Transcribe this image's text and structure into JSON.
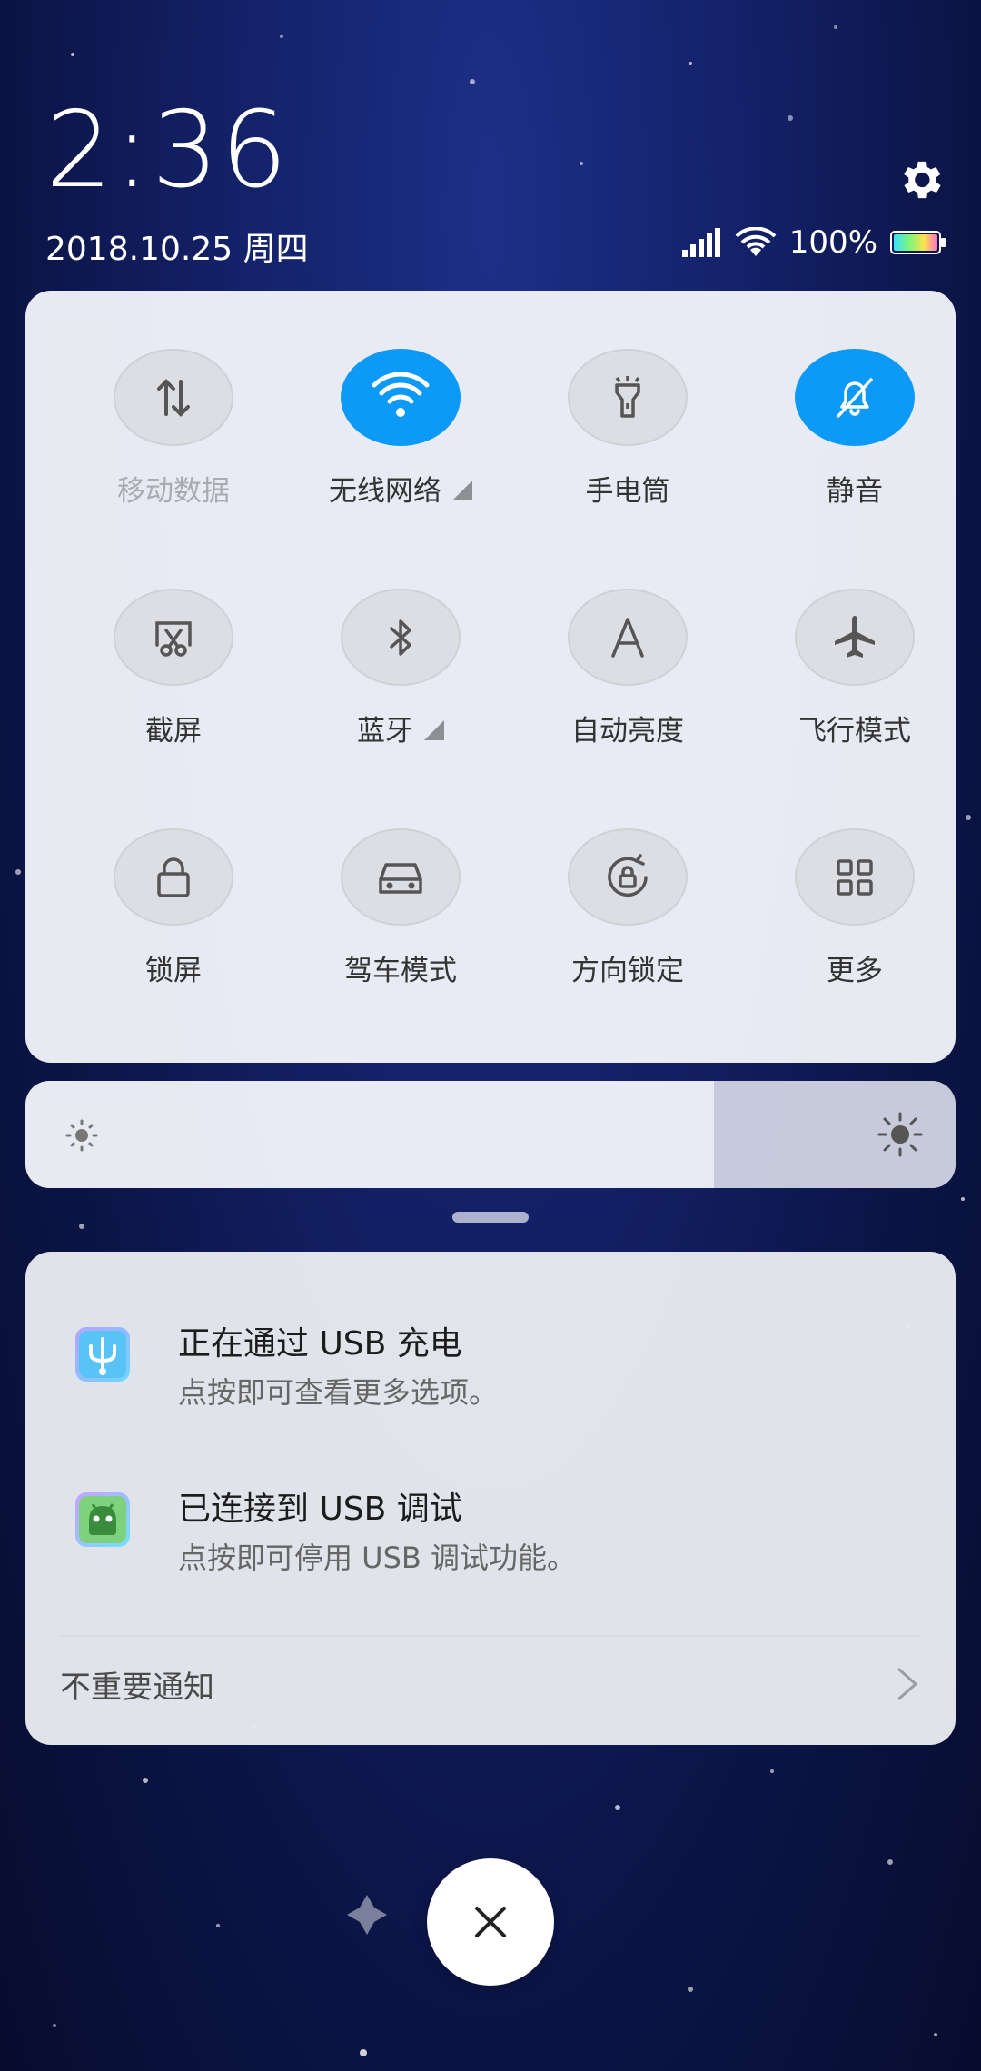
{
  "header": {
    "time": "2:36",
    "date": "2018.10.25 周四",
    "battery_text": "100%"
  },
  "quick_settings": [
    {
      "label": "移动数据",
      "icon": "mobile-data-icon",
      "active": false,
      "dim": true,
      "expand": false
    },
    {
      "label": "无线网络",
      "icon": "wifi-icon",
      "active": true,
      "dim": false,
      "expand": true
    },
    {
      "label": "手电筒",
      "icon": "flashlight-icon",
      "active": false,
      "dim": false,
      "expand": false
    },
    {
      "label": "静音",
      "icon": "bell-muted-icon",
      "active": true,
      "dim": false,
      "expand": false
    },
    {
      "label": "截屏",
      "icon": "screenshot-icon",
      "active": false,
      "dim": false,
      "expand": false
    },
    {
      "label": "蓝牙",
      "icon": "bluetooth-icon",
      "active": false,
      "dim": false,
      "expand": true
    },
    {
      "label": "自动亮度",
      "icon": "auto-brightness-icon",
      "active": false,
      "dim": false,
      "expand": false
    },
    {
      "label": "飞行模式",
      "icon": "airplane-icon",
      "active": false,
      "dim": false,
      "expand": false
    },
    {
      "label": "锁屏",
      "icon": "lock-icon",
      "active": false,
      "dim": false,
      "expand": false
    },
    {
      "label": "驾车模式",
      "icon": "car-icon",
      "active": false,
      "dim": false,
      "expand": false
    },
    {
      "label": "方向锁定",
      "icon": "rotation-lock-icon",
      "active": false,
      "dim": false,
      "expand": false
    },
    {
      "label": "更多",
      "icon": "grid-icon",
      "active": false,
      "dim": false,
      "expand": false
    }
  ],
  "brightness": {
    "level": 0.74
  },
  "notifications": [
    {
      "title": "正在通过 USB 充电",
      "text": "点按即可查看更多选项。",
      "icon": "usb-icon"
    },
    {
      "title": "已连接到 USB 调试",
      "text": "点按即可停用 USB 调试功能。",
      "icon": "android-debug-icon"
    }
  ],
  "unimportant_label": "不重要通知",
  "colors": {
    "accent": "#0d99f6",
    "panel": "#f0f2f8"
  }
}
